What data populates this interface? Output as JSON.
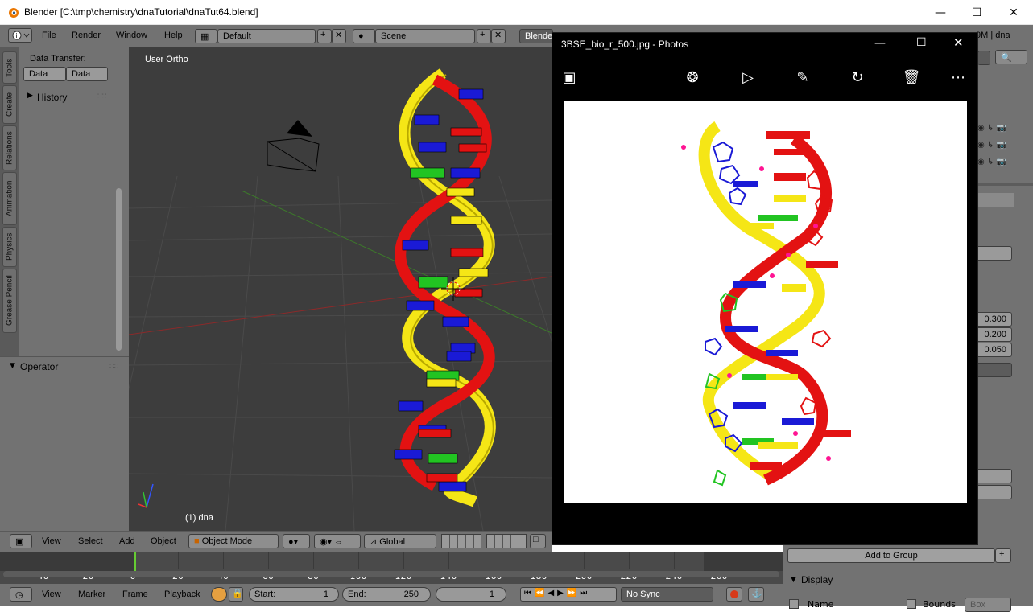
{
  "window": {
    "title": "Blender [C:\\tmp\\chemistry\\dnaTutorial\\dnaTut64.blend]"
  },
  "menubar": {
    "items": [
      "File",
      "Render",
      "Window",
      "Help"
    ],
    "layout": "Default",
    "scene": "Scene",
    "engine": "Blende",
    "stats": "9M | dna"
  },
  "tabs": [
    "Tools",
    "Create",
    "Relations",
    "Animation",
    "Physics",
    "Grease Pencil"
  ],
  "toolpanel": {
    "data_transfer_label": "Data Transfer:",
    "data_btn": "Data",
    "data_layers_btn": "Data La",
    "history": "History"
  },
  "operator": {
    "label": "Operator"
  },
  "viewport": {
    "view_label": "User Ortho",
    "object_label": "(1) dna"
  },
  "vpheader": {
    "view": "View",
    "select": "Select",
    "add": "Add",
    "object": "Object",
    "mode": "Object Mode",
    "orientation": "Global"
  },
  "timeline": {
    "ticks": [
      "-40",
      "-20",
      "0",
      "20",
      "40",
      "60",
      "80",
      "100",
      "120",
      "140",
      "160",
      "180",
      "200",
      "220",
      "240",
      "260"
    ]
  },
  "tlfooter": {
    "view": "View",
    "marker": "Marker",
    "frame": "Frame",
    "playback": "Playback",
    "start_label": "Start:",
    "start_value": "1",
    "end_label": "End:",
    "end_value": "250",
    "current": "1",
    "sync": "No Sync"
  },
  "rightpanel": {
    "values": [
      "0.300",
      "0.200",
      "0.050"
    ],
    "add_to_group": "Add to Group",
    "display": "Display",
    "name_label": "Name",
    "bounds_label": "Bounds",
    "box_label": "Box"
  },
  "photos": {
    "title": "3BSE_bio_r_500.jpg - Photos"
  },
  "colors": {
    "blender_bg": "#727272",
    "viewport_bg": "#3d3d3d",
    "strand_red": "#e31212",
    "strand_yellow": "#f5e616",
    "base_blue": "#1a1ad6",
    "base_green": "#22c422"
  }
}
